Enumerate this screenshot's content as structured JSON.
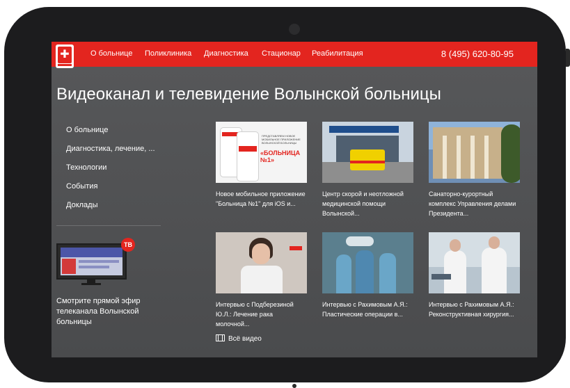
{
  "nav": {
    "items": [
      {
        "label": "О больнице"
      },
      {
        "label": "Поликлиника"
      },
      {
        "label": "Диагностика"
      },
      {
        "label": "Стационар"
      },
      {
        "label": "Реабилитация"
      }
    ],
    "phone": "8 (495) 620-80-95"
  },
  "page": {
    "title": "Видеоканал и телевидение Волынской больницы"
  },
  "sidebar": {
    "items": [
      {
        "label": "О больнице"
      },
      {
        "label": "Диагностика, лечение, ..."
      },
      {
        "label": "Технологии"
      },
      {
        "label": "События"
      },
      {
        "label": "Доклады"
      }
    ]
  },
  "live": {
    "badge": "ТВ",
    "text": "Смотрите прямой эфир телеканала Волынской больницы"
  },
  "videos": [
    {
      "caption": "Новое мобильное приложение \"Больница №1\" для iOS и..."
    },
    {
      "caption": "Центр скорой и неотложной медицинской помощи Волынской..."
    },
    {
      "caption": "Санаторно-курортный комплекс Управления делами Президента..."
    },
    {
      "caption": "Интервью с Подберезиной Ю.Л.: Лечение рака молочной..."
    },
    {
      "caption": "Интервью с Рахимовым А.Я.: Пластические операции в..."
    },
    {
      "caption": "Интервью с Рахимовым А.Я.: Реконструктивная хирургия..."
    }
  ],
  "thumb_texts": {
    "app_promo_small": "ПРЕДСТАВЛЯЕМ НОВОЕ МОБИЛЬНОЕ ПРИЛОЖЕНИЕ ВОЛЫНСКОЙ БОЛЬНИЦЫ",
    "app_promo_big": "«БОЛЬНИЦА №1»"
  },
  "all_videos_label": "Всё видео",
  "colors": {
    "accent_red": "#e3251f",
    "screen_background": "#4a4b4d",
    "tablet_bezel": "#1c1c1e"
  },
  "icons": {
    "logo": "hospital-cross-shield",
    "all_videos": "film-icon"
  }
}
